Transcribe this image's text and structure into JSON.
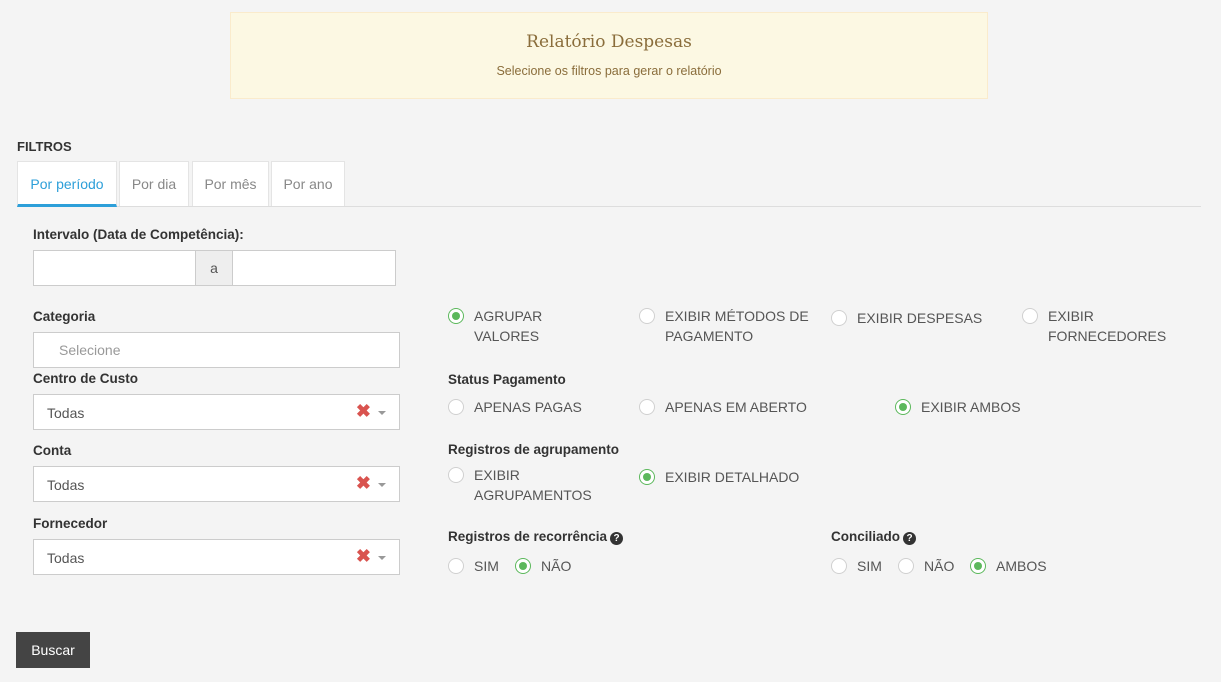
{
  "banner": {
    "title": "Relatório Despesas",
    "subtitle": "Selecione os filtros para gerar o relatório"
  },
  "filters": {
    "heading": "FILTROS",
    "tabs": [
      {
        "label": "Por período",
        "active": true
      },
      {
        "label": "Por dia",
        "active": false
      },
      {
        "label": "Por mês",
        "active": false
      },
      {
        "label": "Por ano",
        "active": false
      }
    ]
  },
  "interval": {
    "label": "Intervalo (Data de Competência):",
    "start_value": "",
    "separator": "a",
    "end_value": ""
  },
  "categoria": {
    "label": "Categoria",
    "placeholder": "Selecione"
  },
  "centro_custo": {
    "label": "Centro de Custo",
    "value": "Todas",
    "clear": "✖"
  },
  "conta": {
    "label": "Conta",
    "value": "Todas",
    "clear": "✖"
  },
  "fornecedor": {
    "label": "Fornecedor",
    "value": "Todas",
    "clear": "✖"
  },
  "display_options": [
    {
      "label": "AGRUPAR VALORES",
      "checked": true
    },
    {
      "label": "EXIBIR MÉTODOS DE PAGAMENTO",
      "checked": false
    },
    {
      "label": "EXIBIR DESPESAS",
      "checked": false
    },
    {
      "label": "EXIBIR FORNECEDORES",
      "checked": false
    }
  ],
  "status_pagamento": {
    "label": "Status Pagamento",
    "options": [
      {
        "label": "APENAS PAGAS",
        "checked": false
      },
      {
        "label": "APENAS EM ABERTO",
        "checked": false
      },
      {
        "label": "EXIBIR AMBOS",
        "checked": true
      }
    ]
  },
  "registros_agrupamento": {
    "label": "Registros de agrupamento",
    "options": [
      {
        "label": "EXIBIR AGRUPAMENTOS",
        "checked": false
      },
      {
        "label": "EXIBIR DETALHADO",
        "checked": true
      }
    ]
  },
  "registros_recorrencia": {
    "label": "Registros de recorrência",
    "options": [
      {
        "label": "SIM",
        "checked": false
      },
      {
        "label": "NÃO",
        "checked": true
      }
    ]
  },
  "conciliado": {
    "label": "Conciliado",
    "options": [
      {
        "label": "SIM",
        "checked": false
      },
      {
        "label": "NÃO",
        "checked": false
      },
      {
        "label": "AMBOS",
        "checked": true
      }
    ]
  },
  "search_button": "Buscar",
  "colors": {
    "accent": "#2d9fd9",
    "radio_checked": "#5cb85c",
    "clear_icon": "#d9534f",
    "banner_bg": "#fcf8e3",
    "button_bg": "#444444"
  }
}
